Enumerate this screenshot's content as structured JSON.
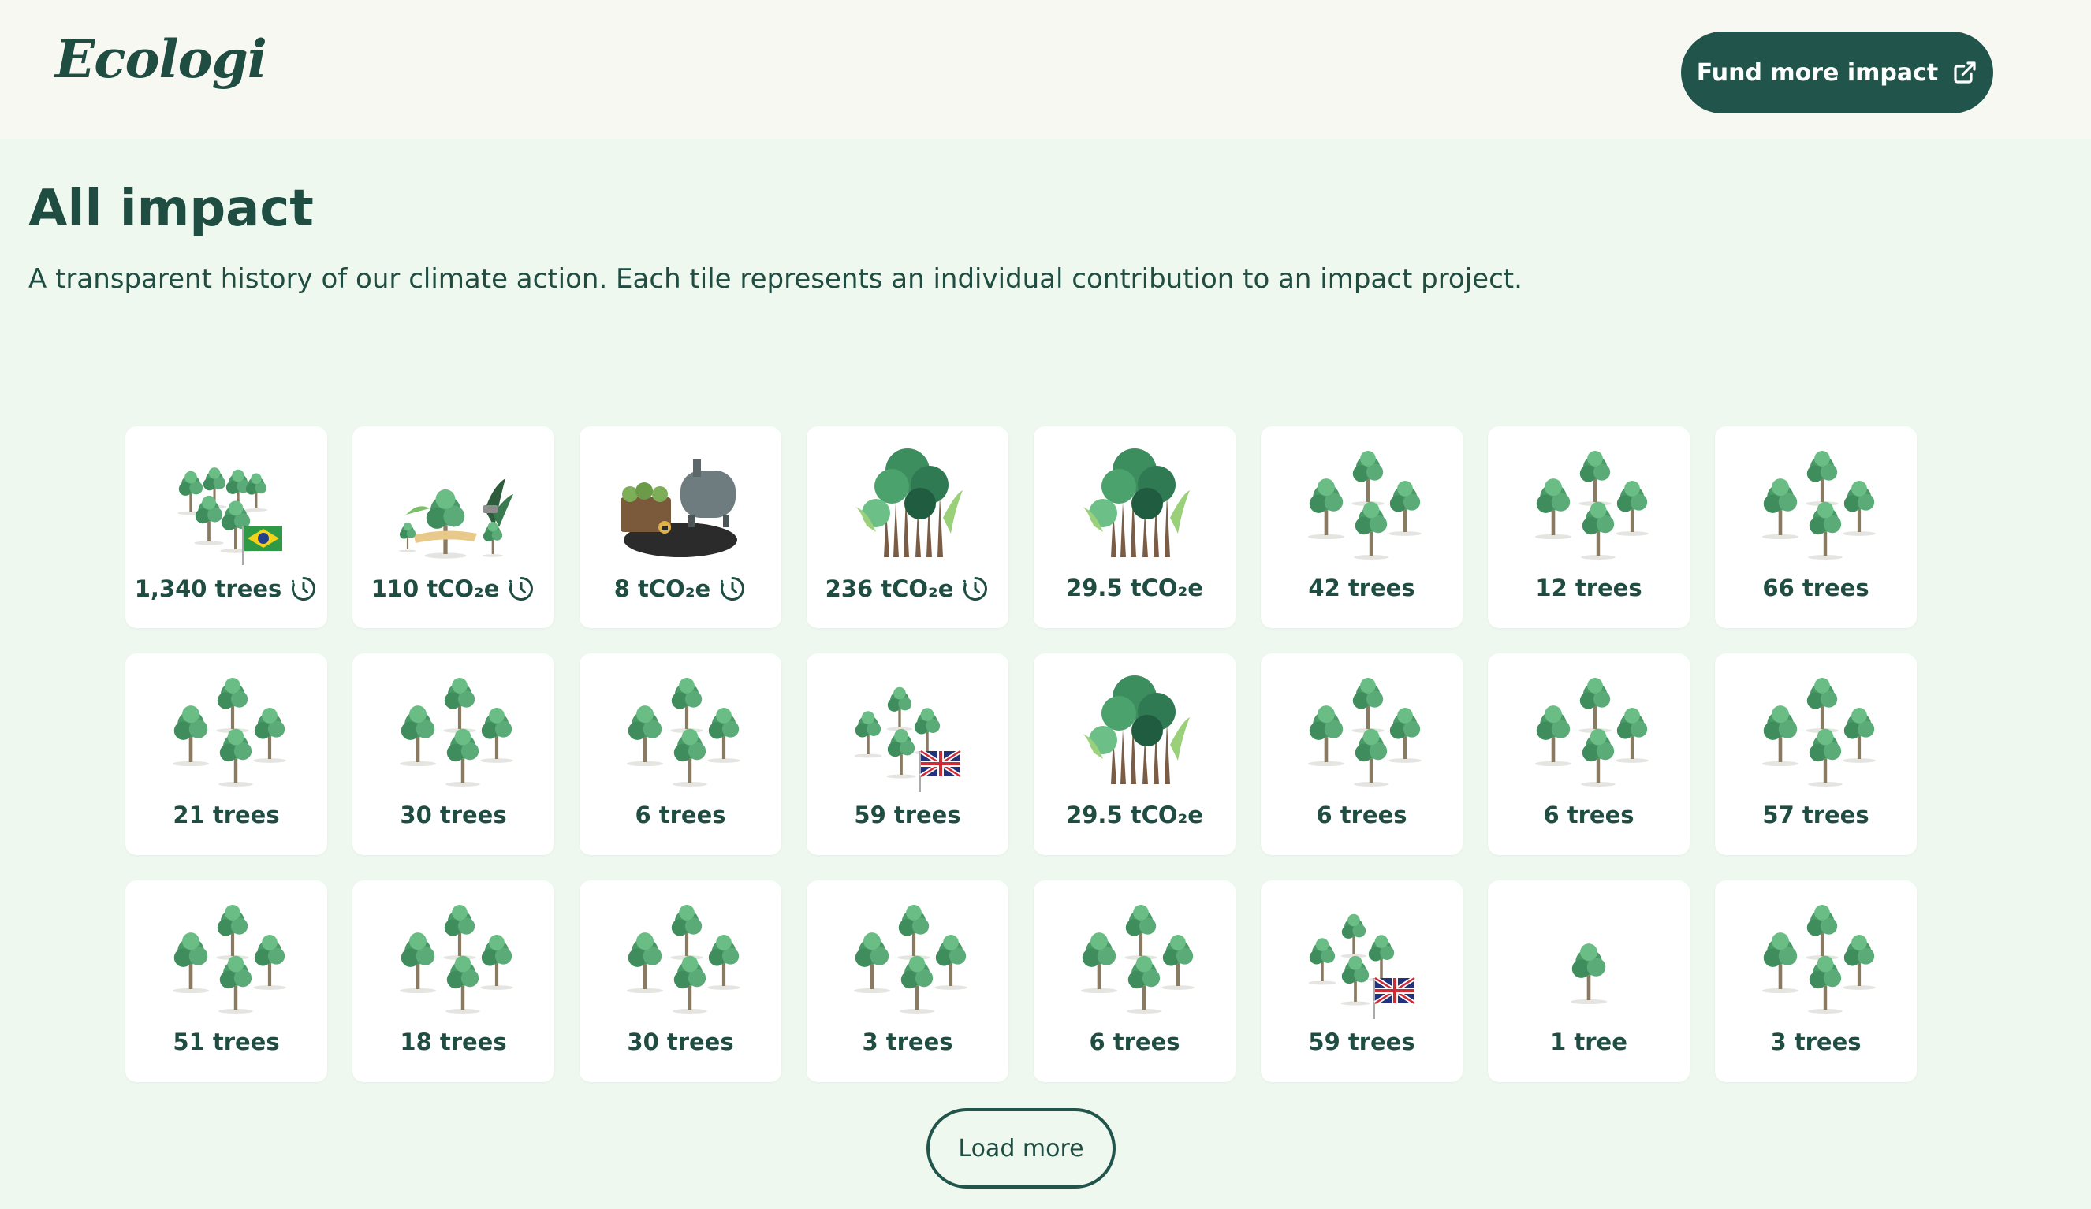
{
  "header": {
    "logo": "Ecologi",
    "fund_button": "Fund more impact",
    "fund_icon": "external-link-icon"
  },
  "page": {
    "title": "All impact",
    "subtitle": "A transparent history of our climate action. Each tile represents an individual contribution to an impact project."
  },
  "tiles": [
    {
      "label": "1,340 trees",
      "art": "trees-brazil-flag",
      "pending": true
    },
    {
      "label": "110 tCO₂e",
      "art": "forest-restoration",
      "pending": true
    },
    {
      "label": "8 tCO₂e",
      "art": "biochar-tank",
      "pending": true
    },
    {
      "label": "236 tCO₂e",
      "art": "rainforest",
      "pending": true
    },
    {
      "label": "29.5 tCO₂e",
      "art": "rainforest",
      "pending": false
    },
    {
      "label": "42 trees",
      "art": "tree-cluster",
      "pending": false
    },
    {
      "label": "12 trees",
      "art": "tree-cluster",
      "pending": false
    },
    {
      "label": "66 trees",
      "art": "tree-cluster",
      "pending": false
    },
    {
      "label": "21 trees",
      "art": "tree-cluster",
      "pending": false
    },
    {
      "label": "30 trees",
      "art": "tree-cluster",
      "pending": false
    },
    {
      "label": "6 trees",
      "art": "tree-cluster",
      "pending": false
    },
    {
      "label": "59 trees",
      "art": "trees-uk-flag",
      "pending": false
    },
    {
      "label": "29.5 tCO₂e",
      "art": "rainforest",
      "pending": false
    },
    {
      "label": "6 trees",
      "art": "tree-cluster",
      "pending": false
    },
    {
      "label": "6 trees",
      "art": "tree-cluster",
      "pending": false
    },
    {
      "label": "57 trees",
      "art": "tree-cluster",
      "pending": false
    },
    {
      "label": "51 trees",
      "art": "tree-cluster",
      "pending": false
    },
    {
      "label": "18 trees",
      "art": "tree-cluster",
      "pending": false
    },
    {
      "label": "30 trees",
      "art": "tree-cluster",
      "pending": false
    },
    {
      "label": "3 trees",
      "art": "tree-cluster",
      "pending": false
    },
    {
      "label": "6 trees",
      "art": "tree-cluster",
      "pending": false
    },
    {
      "label": "59 trees",
      "art": "trees-uk-flag",
      "pending": false
    },
    {
      "label": "1 tree",
      "art": "single-tree",
      "pending": false
    },
    {
      "label": "3 trees",
      "art": "tree-cluster",
      "pending": false
    }
  ],
  "load_more": "Load more",
  "colors": {
    "brand": "#21544a",
    "background": "#eef8ef",
    "header_bg": "#f8f8f3",
    "tree_green": "#4a9a68",
    "trunk": "#8a7a62"
  }
}
